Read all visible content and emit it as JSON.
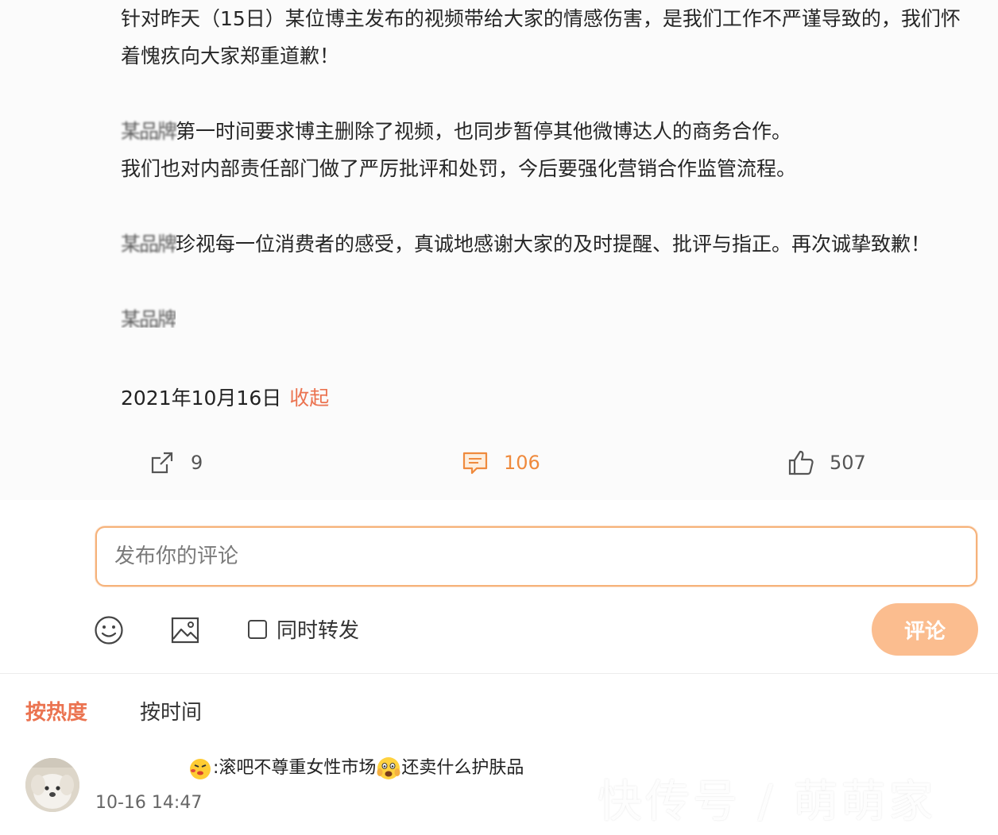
{
  "post": {
    "para1": "针对昨天（15日）某位博主发布的视频带给大家的情感伤害，是我们工作不严谨导致的，我们怀着愧疚向大家郑重道歉！",
    "para2_brand": "某品牌",
    "para2_rest": "第一时间要求博主删除了视频，也同步暂停其他微博达人的商务合作。",
    "para2_line2": "我们也对内部责任部门做了严厉批评和处罚，今后要强化营销合作监管流程。",
    "para3_brand": "某品牌",
    "para3_rest": "珍视每一位消费者的感受，真诚地感谢大家的及时提醒、批评与指正。再次诚挚致歉！",
    "signature": "某品牌",
    "date": "2021年10月16日",
    "collapse_label": "收起"
  },
  "actions": {
    "share_count": "9",
    "comment_count": "106",
    "like_count": "507"
  },
  "composer": {
    "placeholder": "发布你的评论",
    "repost_label": "同时转发",
    "submit_label": "评论"
  },
  "sort": {
    "hot_label": "按热度",
    "time_label": "按时间"
  },
  "comment": {
    "text_part1": ":滚吧不尊重女性市场",
    "text_part2": "还卖什么护肤品",
    "time": "10-16 14:47"
  },
  "watermark": "快传号 / 萌萌家"
}
